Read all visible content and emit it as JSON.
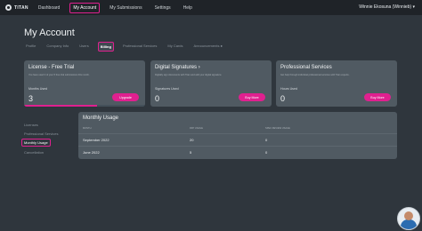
{
  "nav": {
    "brand": "TITAN",
    "links": [
      "Dashboard",
      "My Account",
      "My Submissions",
      "Settings",
      "Help"
    ],
    "active": "My Account",
    "user": "Winnie Ekosuna (Winnieb) ▾"
  },
  "page": {
    "title": "My Account"
  },
  "subtabs": [
    "Profile",
    "Company Info",
    "Users",
    "Billing",
    "Professional Services",
    "My Cards",
    "Announcements ●"
  ],
  "cards": [
    {
      "title": "License - Free Trial",
      "desc": "You have used 3 of your 5 free trial submissions this month.",
      "label": "Months Used",
      "value": "3",
      "button": "Upgrade",
      "progress": 0.6
    },
    {
      "title": "Digital Signatures ›",
      "desc": "Digitally sign documents with Titan and add your digital signature.",
      "label": "Signatures Used",
      "value": "0",
      "button": "Buy More"
    },
    {
      "title": "Professional Services",
      "desc": "Get help through individual professional services with Titan experts.",
      "label": "Hours Used",
      "value": "0",
      "button": "Buy More"
    }
  ],
  "sidebar": [
    "Licenses",
    "Professional Services",
    "Monthly Usage",
    "Cancellation"
  ],
  "usage": {
    "title": "Monthly Usage",
    "columns": [
      "MONTH",
      "RFP USAGE",
      "SPEC REVIEW USAGE"
    ],
    "rows": [
      {
        "month": "September 2022",
        "rfp": "20",
        "spec": "0"
      },
      {
        "month": "June 2022",
        "rfp": "5",
        "spec": "0"
      }
    ]
  },
  "colors": {
    "accent": "#e0208f",
    "nav_bg": "#1f2328",
    "page_bg": "#2f363d",
    "card_bg": "#505a62"
  },
  "icons": [
    "titan-logo-icon",
    "chat-avatar-icon"
  ]
}
